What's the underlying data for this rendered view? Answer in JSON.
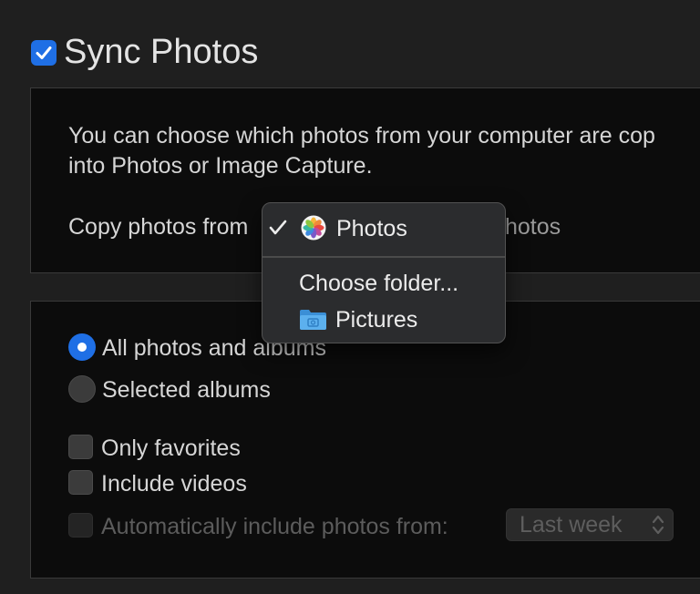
{
  "header": {
    "title": "Sync Photos",
    "sync_checked": true
  },
  "source_panel": {
    "description_line1": "You can choose which photos from your computer are cop",
    "description_line2": "into Photos or Image Capture.",
    "copy_from_label": "Copy photos from",
    "selected_value_partial": "hotos"
  },
  "menu": {
    "items": [
      {
        "label": "Photos",
        "icon": "photos-app-icon",
        "checked": true
      },
      {
        "label": "Choose folder..."
      },
      {
        "label": "Pictures",
        "icon": "folder-icon"
      }
    ]
  },
  "options_panel": {
    "radio_all": {
      "label": "All photos and albums",
      "selected": true
    },
    "radio_selected": {
      "label": "Selected albums",
      "selected": false
    },
    "only_favorites": {
      "label": "Only favorites",
      "checked": false
    },
    "include_videos": {
      "label": "Include videos",
      "checked": false
    },
    "auto_include": {
      "label": "Automatically include photos from:",
      "checked": false,
      "enabled": false
    },
    "auto_range": {
      "value": "Last week",
      "enabled": false
    }
  },
  "colors": {
    "accent": "#1f6fe5",
    "background": "#1f1f1f",
    "panel": "#0c0c0c"
  }
}
